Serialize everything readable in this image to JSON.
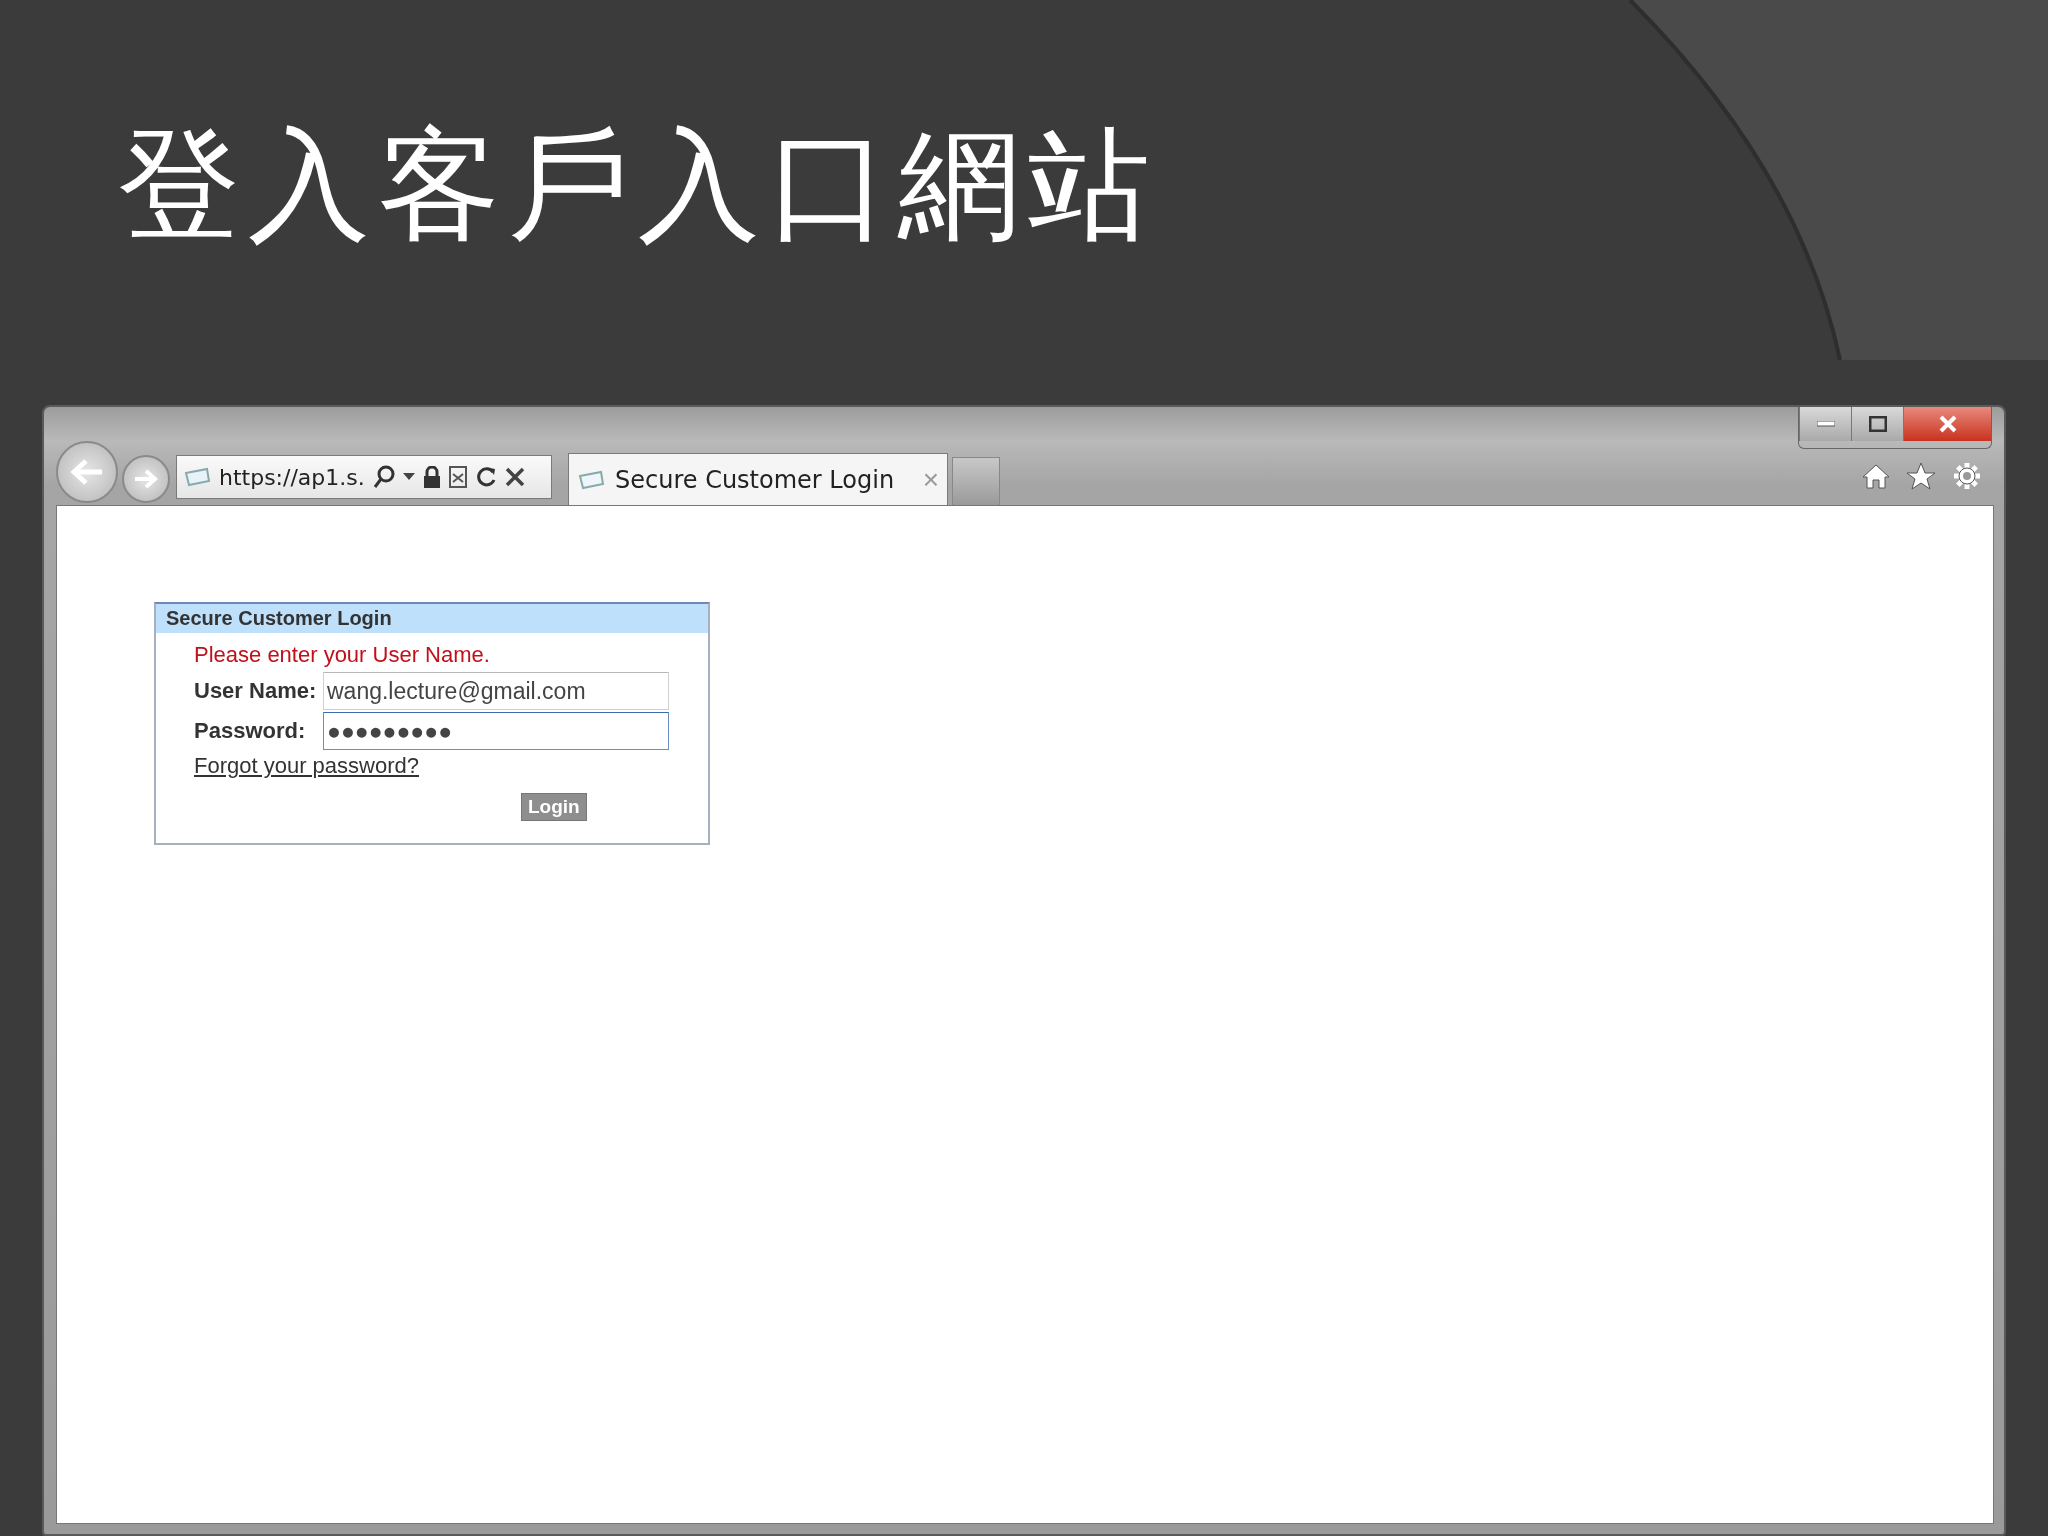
{
  "slide": {
    "title": "登入客戶入口網站"
  },
  "browser": {
    "address": "https://ap1.s.",
    "tab": {
      "label": "Secure Customer Login",
      "close": "×",
      "selected": true
    }
  },
  "login_panel": {
    "title": "Secure Customer Login",
    "error": "Please enter your User Name.",
    "fields": [
      {
        "label": "User Name:",
        "value": "wang.lecture@gmail.com",
        "focused": false
      },
      {
        "label": "Password:",
        "value": "●●●●●●●●●",
        "focused": true
      }
    ],
    "forgot_link": "Forgot your password?",
    "button": "Login"
  }
}
